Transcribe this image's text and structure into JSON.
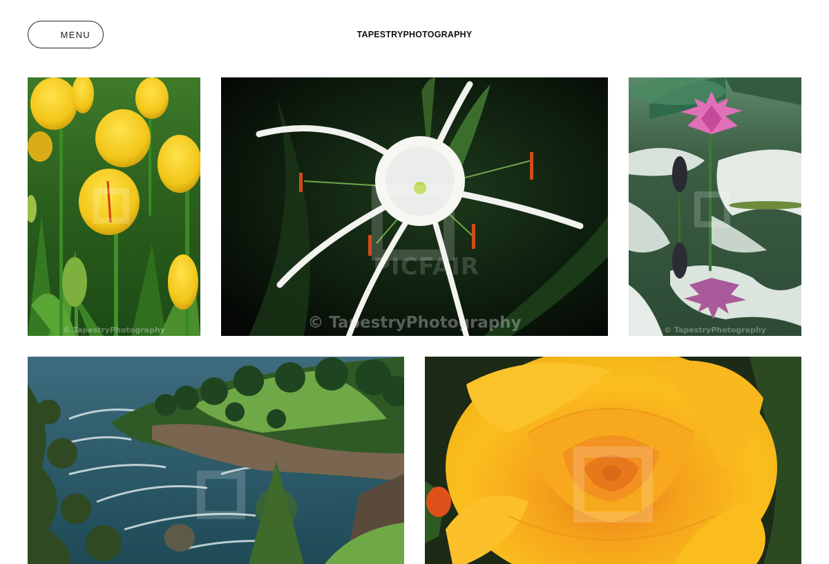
{
  "header": {
    "menu_label": "MENU",
    "site_title": "TAPESTRYPHOTOGRAPHY"
  },
  "gallery": {
    "photos": [
      {
        "subject": "yellow tulips",
        "watermark": "© TapestryPhotography"
      },
      {
        "subject": "white spider lily",
        "watermark": "© TapestryPhotography",
        "brand_mark": "PICFAIR"
      },
      {
        "subject": "pink water lily",
        "watermark": "© TapestryPhotography"
      },
      {
        "subject": "coastal cliffs",
        "watermark": ""
      },
      {
        "subject": "yellow rose",
        "watermark": ""
      }
    ]
  },
  "colors": {
    "background": "#ffffff",
    "text": "#111111",
    "tulip_yellow": "#f2cc1c",
    "rose_yellow": "#f7b418",
    "lily_pink": "#d9509e",
    "ocean": "#2d5a6a"
  }
}
